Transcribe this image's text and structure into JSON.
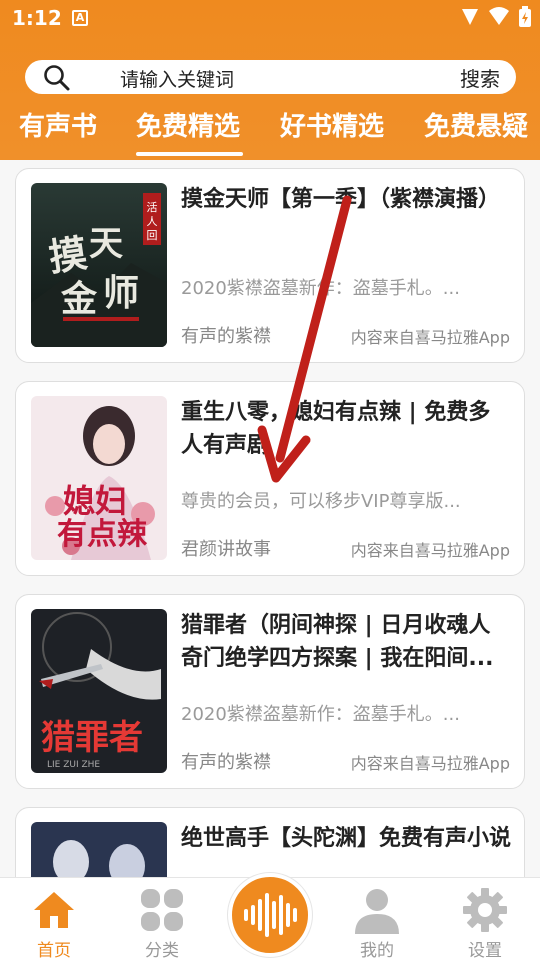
{
  "status": {
    "time": "1:12",
    "notif_letter": "A"
  },
  "search": {
    "placeholder": "请输入关键词",
    "button": "搜索"
  },
  "tabs": [
    {
      "label": "有声书"
    },
    {
      "label": "免费精选"
    },
    {
      "label": "好书精选"
    },
    {
      "label": "免费悬疑"
    }
  ],
  "active_tab": "免费精选",
  "books": [
    {
      "title": "摸金天师【第一季】（紫襟演播）",
      "desc": "2020紫襟盗墓新作：盗墓手札。...",
      "author": "有声的紫襟",
      "source": "内容来自喜马拉雅App",
      "cover_text": "摸金天师"
    },
    {
      "title": "重生八零，媳妇有点辣 | 免费多人有声剧",
      "desc": "尊贵的会员，可以移步VIP尊享版...",
      "author": "君颜讲故事",
      "source": "内容来自喜马拉雅App",
      "cover_text": "媳妇有点辣"
    },
    {
      "title": "猎罪者（阴间神探 | 日月收魂人 奇门绝学四方探案 | 我在阳间...",
      "desc": "2020紫襟盗墓新作：盗墓手札。...",
      "author": "有声的紫襟",
      "source": "内容来自喜马拉雅App",
      "cover_text": "猎罪者"
    },
    {
      "title": "绝世高手【头陀渊】免费有声小说",
      "desc": "",
      "author": "",
      "source": "",
      "cover_text": ""
    }
  ],
  "bottom_nav": [
    {
      "label": "首页",
      "icon": "home-icon",
      "active": true
    },
    {
      "label": "分类",
      "icon": "grid-icon",
      "active": false
    },
    {
      "label": "我的",
      "icon": "user-icon",
      "active": false
    },
    {
      "label": "设置",
      "icon": "gear-icon",
      "active": false
    }
  ],
  "colors": {
    "accent": "#ef8a1f",
    "annotation_arrow": "#c0201a"
  }
}
